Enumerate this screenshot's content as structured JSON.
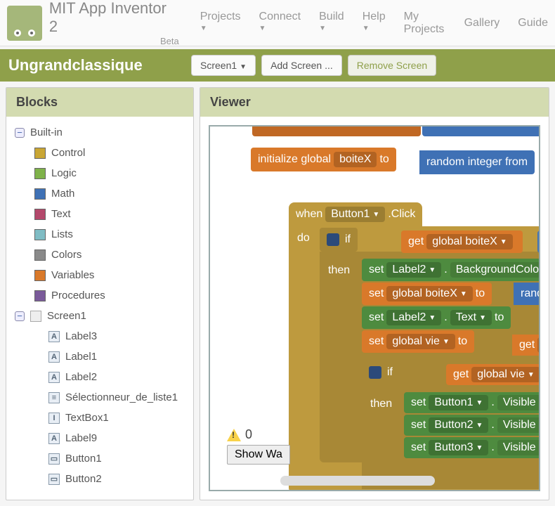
{
  "brand": {
    "title": "MIT App Inventor 2",
    "beta": "Beta"
  },
  "topmenu": {
    "projects": "Projects",
    "connect": "Connect",
    "build": "Build",
    "help": "Help",
    "myprojects": "My Projects",
    "gallery": "Gallery",
    "guide": "Guide"
  },
  "project": {
    "name": "Ungrandclassique",
    "screen_dropdown": "Screen1",
    "add_screen": "Add Screen ...",
    "remove_screen": "Remove Screen"
  },
  "panels": {
    "blocks": "Blocks",
    "viewer": "Viewer"
  },
  "tree": {
    "builtin": "Built-in",
    "categories": [
      {
        "label": "Control",
        "color": "#c9a634"
      },
      {
        "label": "Logic",
        "color": "#7fb24a"
      },
      {
        "label": "Math",
        "color": "#3f71b5"
      },
      {
        "label": "Text",
        "color": "#b3486b"
      },
      {
        "label": "Lists",
        "color": "#7fbcc4"
      },
      {
        "label": "Colors",
        "color": "#8a8a8a"
      },
      {
        "label": "Variables",
        "color": "#d9792a"
      },
      {
        "label": "Procedures",
        "color": "#7a5a9a"
      }
    ],
    "screen": "Screen1",
    "components": [
      {
        "label": "Label3",
        "icon": "A"
      },
      {
        "label": "Label1",
        "icon": "A"
      },
      {
        "label": "Label2",
        "icon": "A"
      },
      {
        "label": "Sélectionneur_de_liste1",
        "icon": "≡"
      },
      {
        "label": "TextBox1",
        "icon": "I"
      },
      {
        "label": "Label9",
        "icon": "A"
      },
      {
        "label": "Button1",
        "icon": "▭"
      },
      {
        "label": "Button2",
        "icon": "▭"
      }
    ]
  },
  "viewer": {
    "init_label": "initialize global",
    "init_var": "boiteX",
    "to": "to",
    "rand": "random integer from",
    "when": "when",
    "when_comp": "Button1",
    "when_event": ".Click",
    "do": "do",
    "if": "if",
    "then": "then",
    "get": "get",
    "set": "set",
    "eq": "=",
    "global_boiteX": "global boiteX",
    "global_vie": "global vie",
    "label2": "Label2",
    "bgcolor": "BackgroundColo",
    "text": "Text",
    "random": "random",
    "button1": "Button1",
    "button2": "Button2",
    "button3": "Button3",
    "visible": "Visible",
    "gl_prefix": "gl",
    "warnings_count": "0",
    "show_warnings": "Show Wa"
  }
}
